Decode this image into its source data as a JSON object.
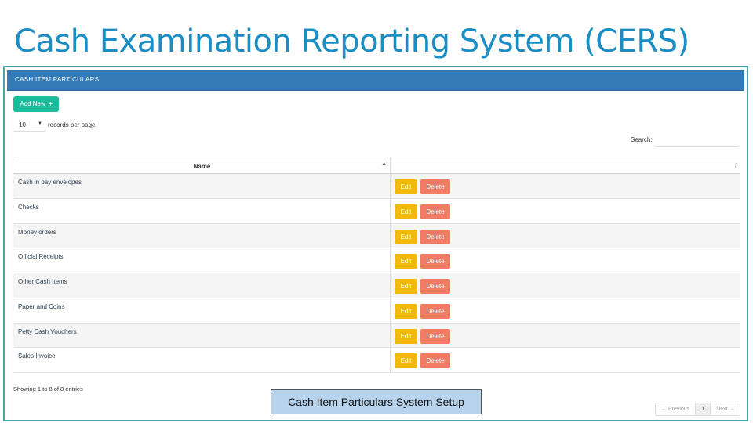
{
  "slide": {
    "title": "Cash Examination Reporting System (CERS)",
    "caption": "Cash Item Particulars System Setup"
  },
  "panel": {
    "title": "CASH ITEM PARTICULARS",
    "header_color": "#337ab7"
  },
  "toolbar": {
    "add_label": "Add New",
    "add_icon": "plus-icon"
  },
  "length_menu": {
    "selected": "10",
    "label": "records per page"
  },
  "search": {
    "label": "Search:",
    "value": ""
  },
  "table": {
    "headers": [
      "Name",
      ""
    ],
    "rows": [
      {
        "name": "Cash in pay envelopes",
        "edit": "Edit",
        "delete": "Delete"
      },
      {
        "name": "Checks",
        "edit": "Edit",
        "delete": "Delete"
      },
      {
        "name": "Money orders",
        "edit": "Edit",
        "delete": "Delete"
      },
      {
        "name": "Official Receipts",
        "edit": "Edit",
        "delete": "Delete"
      },
      {
        "name": "Other Cash Items",
        "edit": "Edit",
        "delete": "Delete"
      },
      {
        "name": "Paper and Coins",
        "edit": "Edit",
        "delete": "Delete"
      },
      {
        "name": "Petty Cash Vouchers",
        "edit": "Edit",
        "delete": "Delete"
      },
      {
        "name": "Sales Invoice",
        "edit": "Edit",
        "delete": "Delete"
      }
    ]
  },
  "footer": {
    "info": "Showing 1 to 8 of 8 entries"
  },
  "pagination": {
    "previous": "← Previous",
    "current": "1",
    "next": "Next →"
  },
  "colors": {
    "title": "#1a8ec4",
    "add_button": "#1abc9c",
    "edit_button": "#f0b90b",
    "delete_button": "#f07c63"
  }
}
